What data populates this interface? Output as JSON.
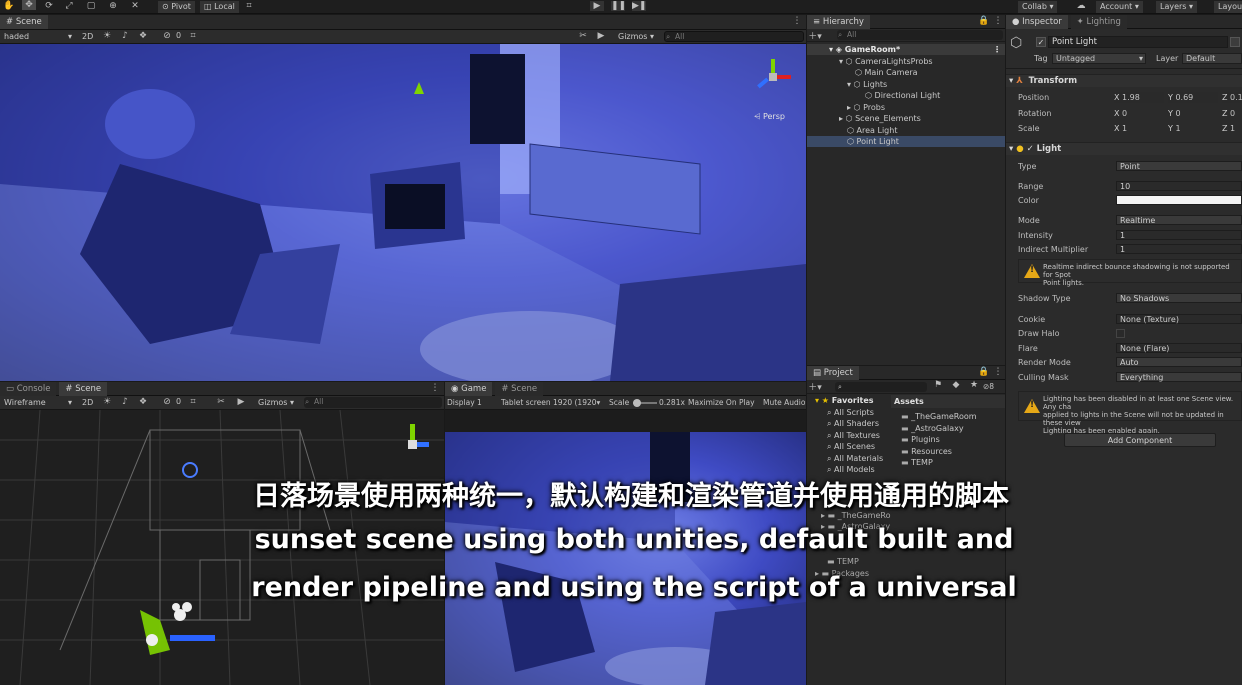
{
  "toolbar": {
    "pivot": "Pivot",
    "local": "Local",
    "collab": "Collab",
    "account": "Account",
    "layers": "Layers",
    "layout": "Layou"
  },
  "scene_top": {
    "tab": "Scene",
    "shading": "haded",
    "mode_2d": "2D",
    "gizmos": "Gizmos",
    "search": "All",
    "persp": "Persp",
    "hidden_count": "0"
  },
  "hierarchy": {
    "tab": "Hierarchy",
    "search": "All",
    "items": [
      {
        "label": "GameRoom*"
      },
      {
        "label": "CameraLightsProbs"
      },
      {
        "label": "Main Camera"
      },
      {
        "label": "Lights"
      },
      {
        "label": "Directional Light"
      },
      {
        "label": "Probs"
      },
      {
        "label": "Scene_Elements"
      },
      {
        "label": "Area Light"
      },
      {
        "label": "Point Light"
      }
    ]
  },
  "inspector": {
    "tab": "Inspector",
    "tab2": "Lighting",
    "object_name": "Point Light",
    "tag_label": "Tag",
    "tag_value": "Untagged",
    "layer_label": "Layer",
    "layer_value": "Default",
    "transform": {
      "title": "Transform",
      "position_label": "Position",
      "rotation_label": "Rotation",
      "scale_label": "Scale",
      "position": {
        "x": "1.98",
        "y": "0.69",
        "z": "0.1"
      },
      "rotation": {
        "x": "0",
        "y": "0",
        "z": "0"
      },
      "scale": {
        "x": "1",
        "y": "1",
        "z": "1"
      }
    },
    "light": {
      "title": "Light",
      "type_label": "Type",
      "type": "Point",
      "range_label": "Range",
      "range": "10",
      "color_label": "Color",
      "mode_label": "Mode",
      "mode": "Realtime",
      "intensity_label": "Intensity",
      "intensity": "1",
      "indirect_label": "Indirect Multiplier",
      "indirect": "1",
      "warning1_line1": "Realtime indirect bounce shadowing is not supported for Spot",
      "warning1_line2": "Point lights.",
      "shadow_label": "Shadow Type",
      "shadow": "No Shadows",
      "cookie_label": "Cookie",
      "cookie": "None (Texture)",
      "halo_label": "Draw Halo",
      "flare_label": "Flare",
      "flare": "None (Flare)",
      "render_label": "Render Mode",
      "render": "Auto",
      "culling_label": "Culling Mask",
      "culling": "Everything",
      "warning2_line1": "Lighting has been disabled in at least one Scene view. Any cha",
      "warning2_line2": "applied to lights in the Scene will not be updated in these view",
      "warning2_line3": "Lighting has been enabled again."
    },
    "add_component": "Add Component"
  },
  "bottom_left": {
    "tab1": "Console",
    "tab2": "Scene",
    "shading": "Wireframe",
    "mode_2d": "2D",
    "gizmos": "Gizmos",
    "search": "All",
    "hidden_count": "0"
  },
  "game": {
    "tab1": "Game",
    "tab2": "Scene",
    "display": "Display 1",
    "resolution": "Tablet screen 1920 (1920",
    "scale_label": "Scale",
    "scale_value": "0.281x",
    "maximize": "Maximize On Play",
    "mute": "Mute Audio"
  },
  "project": {
    "tab": "Project",
    "favorites_label": "Favorites",
    "favorites": [
      "All Scripts",
      "All Shaders",
      "All Textures",
      "All Scenes",
      "All Materials",
      "All Models"
    ],
    "assets_header": "Assets",
    "assets": [
      "_TheGameRoom",
      "_AstroGalaxy",
      "Plugins",
      "Resources",
      "TEMP"
    ],
    "tree_partial": [
      "_TheGameRo",
      "_AstroGalaxy",
      "TEMP"
    ],
    "packages": "Packages",
    "count": "8"
  },
  "subtitles": {
    "zh": "日落场景使用两种统一，默认构建和渲染管道并使用通用的脚本",
    "en1": "sunset scene using both unities, default built and",
    "en2": "render pipeline and using the script of a universal"
  }
}
